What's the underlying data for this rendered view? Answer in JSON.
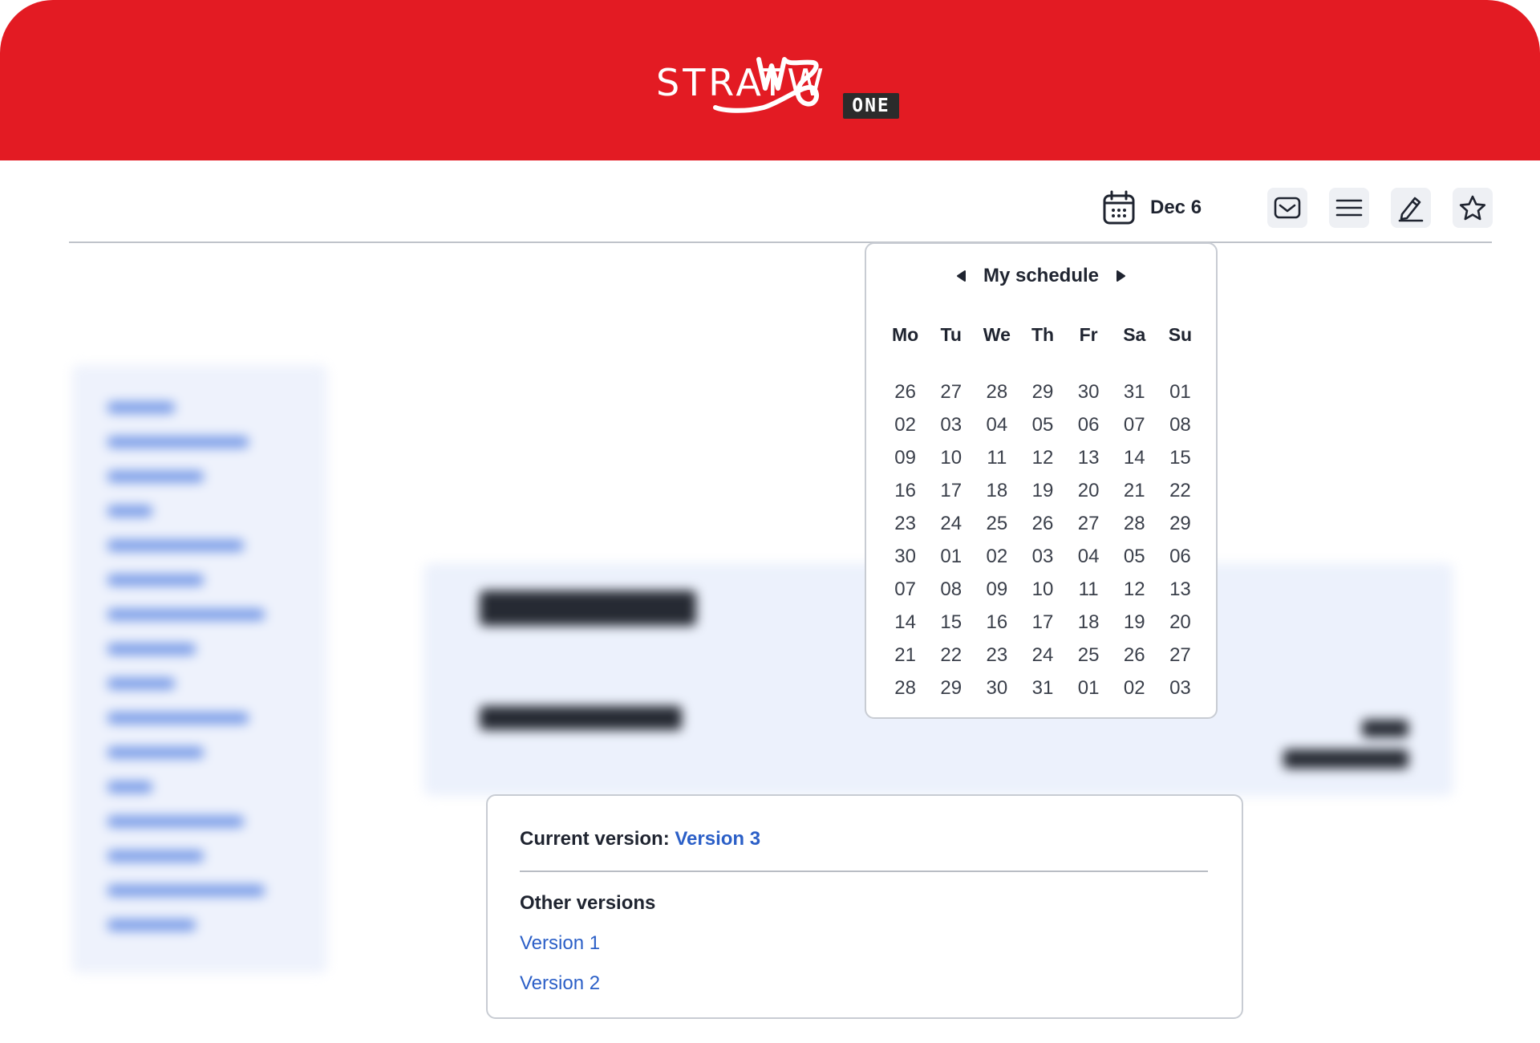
{
  "brand": {
    "wordmark": "STRATW",
    "badge": "ONE",
    "color": "#e31b23"
  },
  "toolbar": {
    "date_label": "Dec 6",
    "icons": [
      "calendar-icon",
      "inbox-icon",
      "menu-icon",
      "edit-icon",
      "star-icon"
    ]
  },
  "calendar": {
    "title": "My schedule",
    "weekdays": [
      "Mo",
      "Tu",
      "We",
      "Th",
      "Fr",
      "Sa",
      "Su"
    ],
    "days": [
      "26",
      "27",
      "28",
      "29",
      "30",
      "31",
      "01",
      "02",
      "03",
      "04",
      "05",
      "06",
      "07",
      "08",
      "09",
      "10",
      "11",
      "12",
      "13",
      "14",
      "15",
      "16",
      "17",
      "18",
      "19",
      "20",
      "21",
      "22",
      "23",
      "24",
      "25",
      "26",
      "27",
      "28",
      "29",
      "30",
      "01",
      "02",
      "03",
      "04",
      "05",
      "06",
      "07",
      "08",
      "09",
      "10",
      "11",
      "12",
      "13",
      "14",
      "15",
      "16",
      "17",
      "18",
      "19",
      "20",
      "21",
      "22",
      "23",
      "24",
      "25",
      "26",
      "27",
      "28",
      "29",
      "30",
      "31",
      "01",
      "02",
      "03"
    ]
  },
  "versions": {
    "current_label": "Current version:",
    "current_value": "Version 3",
    "other_title": "Other versions",
    "others": [
      "Version 1",
      "Version 2"
    ],
    "link_color": "#2b5fc7"
  }
}
